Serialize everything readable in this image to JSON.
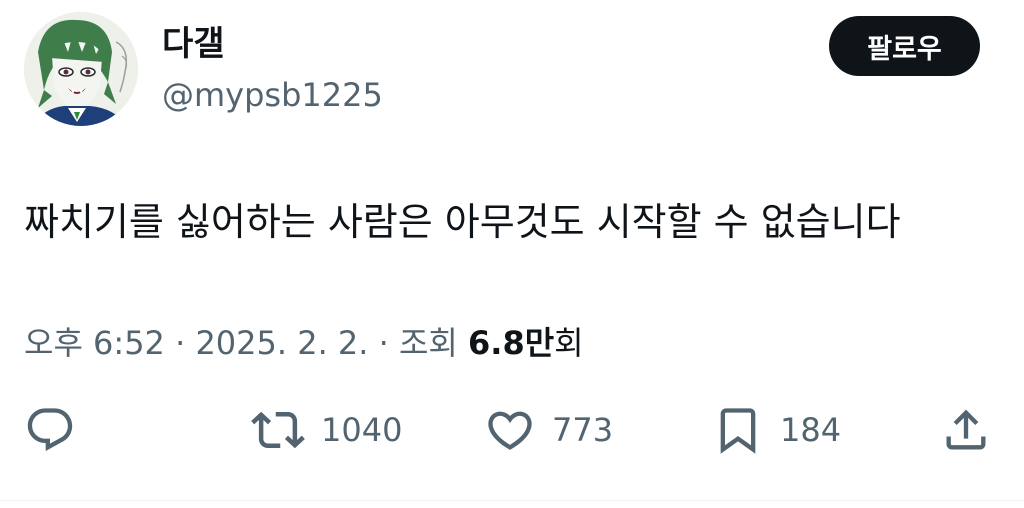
{
  "author": {
    "display_name": "다갤",
    "handle": "@mypsb1225"
  },
  "follow_button": {
    "label": "팔로우"
  },
  "tweet": {
    "text": "짜치기를 싫어하는 사람은 아무것도 시작할 수 없습니다"
  },
  "meta": {
    "time": "오후 6:52",
    "separator": " · ",
    "date": "2025. 2. 2.",
    "views_label": "조회 ",
    "views_count": "6.8만",
    "views_unit": "회"
  },
  "actions": {
    "reply": {
      "icon": "reply-icon"
    },
    "retweet": {
      "icon": "retweet-icon",
      "count": "1040"
    },
    "like": {
      "icon": "heart-icon",
      "count": "773"
    },
    "bookmark": {
      "icon": "bookmark-icon",
      "count": "184"
    },
    "share": {
      "icon": "share-icon"
    }
  },
  "colors": {
    "text_primary": "#0f1419",
    "text_secondary": "#536471",
    "follow_bg": "#0f1419",
    "follow_text": "#ffffff"
  }
}
